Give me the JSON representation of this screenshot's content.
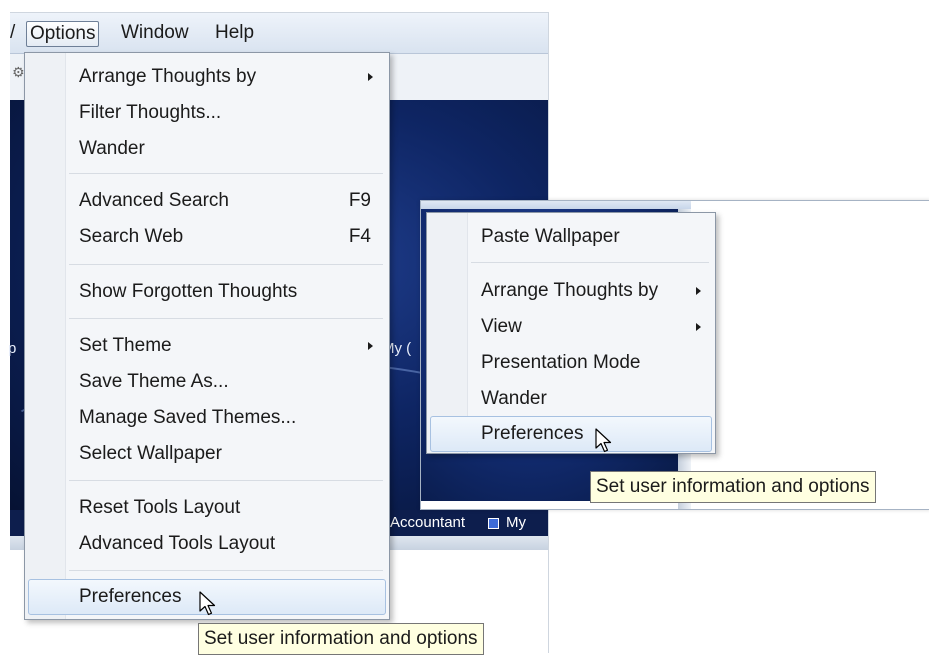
{
  "menubar": {
    "partial_item": "/",
    "items": [
      "Options",
      "Window",
      "Help"
    ],
    "active_index": 0
  },
  "background_labels": {
    "left_edge": "p",
    "my_partial": "My (",
    "accountant": "Accountant",
    "my": "My"
  },
  "options_menu": {
    "groups": [
      [
        {
          "label": "Arrange Thoughts by",
          "submenu": true
        },
        {
          "label": "Filter Thoughts..."
        },
        {
          "label": "Wander"
        }
      ],
      [
        {
          "label": "Advanced Search",
          "shortcut": "F9"
        },
        {
          "label": "Search Web",
          "shortcut": "F4"
        }
      ],
      [
        {
          "label": "Show Forgotten Thoughts"
        }
      ],
      [
        {
          "label": "Set Theme",
          "submenu": true
        },
        {
          "label": "Save Theme As..."
        },
        {
          "label": "Manage Saved Themes..."
        },
        {
          "label": "Select Wallpaper"
        }
      ],
      [
        {
          "label": "Reset Tools Layout"
        },
        {
          "label": "Advanced Tools Layout"
        }
      ],
      [
        {
          "label": "Preferences",
          "highlighted": true
        }
      ]
    ]
  },
  "context_menu": {
    "groups": [
      [
        {
          "label": "Paste Wallpaper"
        }
      ],
      [
        {
          "label": "Arrange Thoughts by",
          "submenu": true
        },
        {
          "label": "View",
          "submenu": true
        },
        {
          "label": "Presentation Mode"
        },
        {
          "label": "Wander"
        },
        {
          "label": "Preferences",
          "highlighted": true
        }
      ]
    ]
  },
  "tooltips": {
    "left": "Set user information and options",
    "right": "Set user information and options"
  },
  "colors": {
    "plex_background": "#0e2563",
    "menu_background": "#f4f6f9",
    "highlight_border": "#a7c1e1",
    "tooltip_background": "#ffffe1"
  },
  "icons": {
    "cursor": "arrow-cursor-icon",
    "submenu": "submenu-arrow-icon"
  }
}
